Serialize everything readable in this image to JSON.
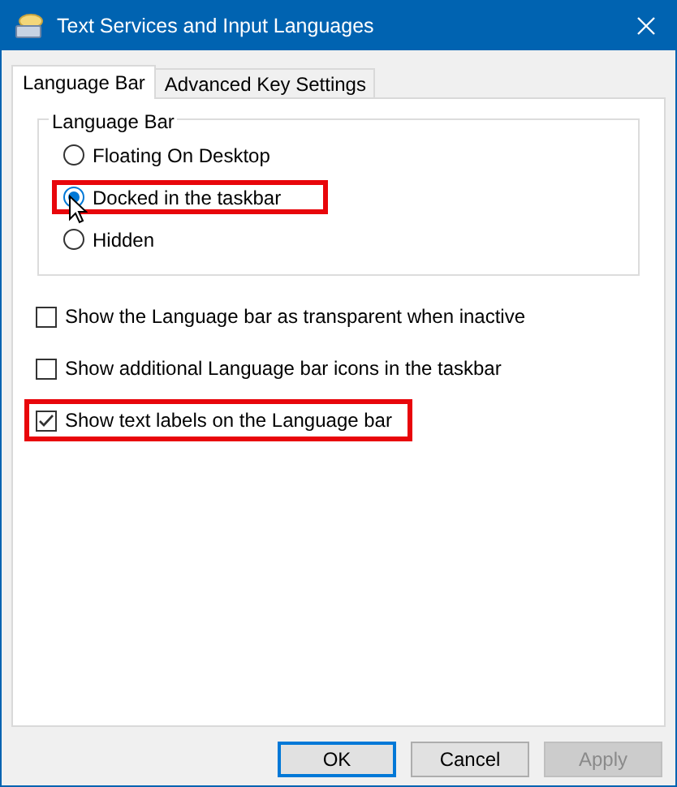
{
  "window": {
    "title": "Text Services and Input Languages"
  },
  "tabs": [
    {
      "label": "Language Bar",
      "selected": true
    },
    {
      "label": "Advanced Key Settings",
      "selected": false
    }
  ],
  "group": {
    "title": "Language Bar",
    "options": [
      {
        "label": "Floating On Desktop",
        "selected": false,
        "highlighted": false
      },
      {
        "label": "Docked in the taskbar",
        "selected": true,
        "highlighted": true
      },
      {
        "label": "Hidden",
        "selected": false,
        "highlighted": false
      }
    ]
  },
  "checkboxes": [
    {
      "label": "Show the Language bar as transparent when inactive",
      "checked": false,
      "highlighted": false
    },
    {
      "label": "Show additional Language bar icons in the taskbar",
      "checked": false,
      "highlighted": false
    },
    {
      "label": "Show text labels on the Language bar",
      "checked": true,
      "highlighted": true
    }
  ],
  "buttons": [
    {
      "label": "OK",
      "default": true,
      "disabled": false
    },
    {
      "label": "Cancel",
      "default": false,
      "disabled": false
    },
    {
      "label": "Apply",
      "default": false,
      "disabled": true
    }
  ]
}
